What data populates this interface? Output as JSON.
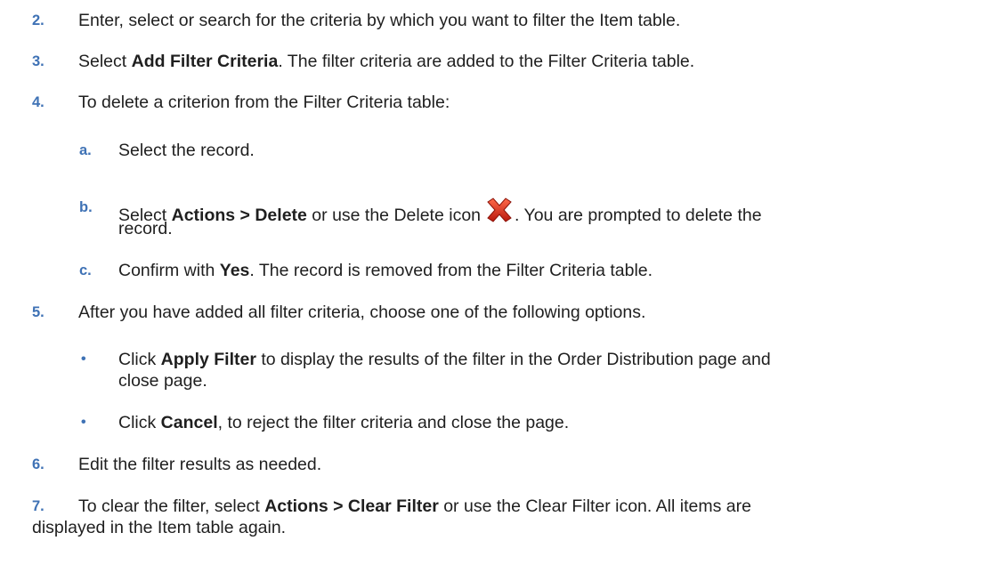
{
  "steps": [
    {
      "num": "2.",
      "text": "Enter, select or search for the criteria by which you want to filter the Item table."
    },
    {
      "num": "3.",
      "pre": "Select ",
      "bold": "Add Filter Criteria",
      "post": ". The filter criteria are added to the Filter Criteria table."
    },
    {
      "num": "4.",
      "text": "To delete a criterion from the Filter Criteria table:"
    },
    {
      "num": "5.",
      "text": "After you have added all filter criteria, choose one of the following options."
    },
    {
      "num": "6.",
      "text": "Edit the filter results as needed."
    },
    {
      "num": "7.",
      "pre": "To clear the filter, select ",
      "bold": "Actions > Clear Filter",
      "post": " or use the Clear Filter icon. All items are",
      "line2": "displayed in the Item table again."
    }
  ],
  "substeps": [
    {
      "num": "a.",
      "text": "Select the record."
    },
    {
      "num": "b.",
      "pre": "Select ",
      "bold": "Actions > Delete",
      "mid": " or use the Delete icon",
      "post": ". You are prompted to delete the",
      "line2": "record."
    },
    {
      "num": "c.",
      "pre": "Confirm with ",
      "bold": "Yes",
      "post": ". The record is removed from the Filter Criteria table."
    }
  ],
  "options": [
    {
      "bullet": "•",
      "pre": "Click ",
      "bold": "Apply Filter",
      "post": " to display the results of the filter in the Order Distribution page and",
      "line2": "close page."
    },
    {
      "bullet": "•",
      "pre": "Click ",
      "bold": "Cancel",
      "post": ", to reject the filter criteria and close the page."
    }
  ],
  "icons": {
    "delete": "delete-x-icon",
    "delete_color": "#d62a1a",
    "accent": "#3f72b5"
  }
}
